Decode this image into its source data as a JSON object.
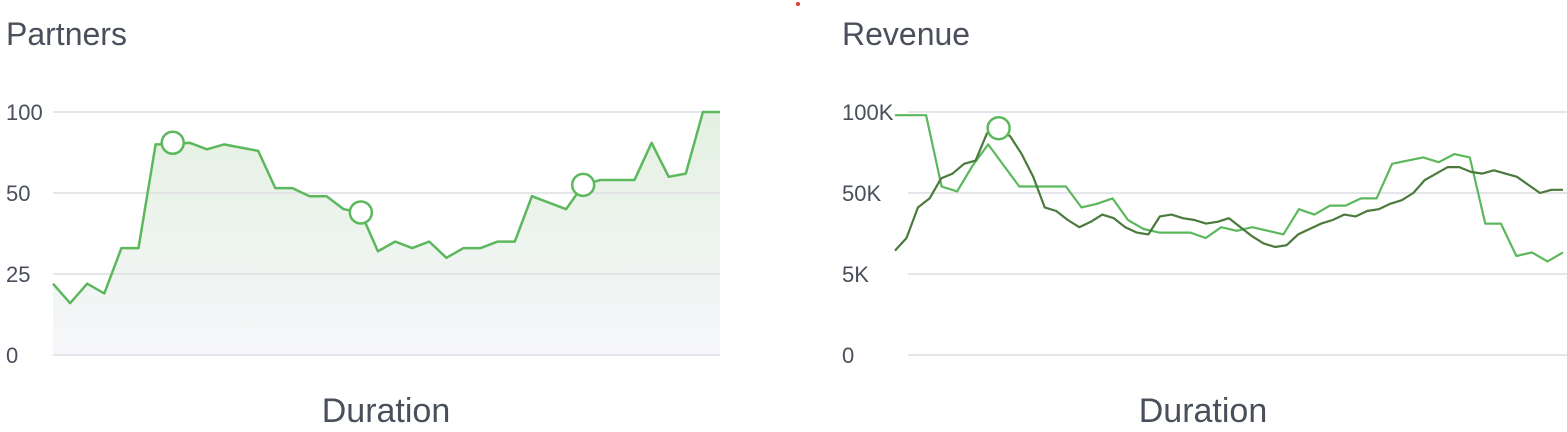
{
  "chart_data": [
    {
      "type": "area",
      "title": "Partners",
      "xlabel": "Duration",
      "ylabel": "",
      "y_ticks": [
        "0",
        "25",
        "50",
        "100"
      ],
      "ylim": [
        0,
        100
      ],
      "grid": true,
      "colors": {
        "line": "#5cb85c",
        "fill_top": "#e4f1e1",
        "fill_bottom": "#f6f6fa",
        "grid": "#dcdde3"
      },
      "series": [
        {
          "values": [
            22,
            16,
            22,
            19,
            33,
            33,
            80,
            80,
            81,
            77,
            80,
            78,
            76,
            53,
            53,
            49,
            49,
            45,
            44,
            32,
            35,
            33,
            35,
            30,
            33,
            33,
            35,
            35,
            49,
            47,
            45,
            55,
            58,
            58,
            58,
            81,
            60,
            62,
            100,
            100
          ]
        }
      ],
      "markers": [
        {
          "index": 7,
          "value": 81
        },
        {
          "index": 18,
          "value": 44
        },
        {
          "index": 31,
          "value": 55
        }
      ]
    },
    {
      "type": "line",
      "title": "Revenue",
      "xlabel": "Duration",
      "ylabel": "",
      "y_ticks": [
        "0",
        "5K",
        "50K",
        "100K"
      ],
      "ylim": [
        0,
        100000
      ],
      "grid": true,
      "colors": {
        "light": "#5cb85c",
        "dark": "#4a7a3c",
        "grid": "#dcdde3"
      },
      "series": [
        {
          "values": [
            98000,
            98000,
            98000,
            54000,
            51000,
            67000,
            80000,
            67000,
            54000,
            54000,
            54000,
            54000,
            42000,
            44000,
            47000,
            35000,
            30000,
            28000,
            28000,
            28000,
            25000,
            31000,
            29000,
            31000,
            29000,
            27000,
            41000,
            38000,
            43000,
            43000,
            47000,
            47000,
            68000,
            70000,
            72000,
            69000,
            74000,
            72000,
            33000,
            33000,
            15000,
            17000,
            12000,
            17000
          ]
        },
        {
          "values": [
            18000,
            25000,
            42000,
            47000,
            59000,
            62000,
            68000,
            70000,
            87000,
            90000,
            85000,
            74000,
            60000,
            42000,
            40000,
            35000,
            31000,
            34000,
            38000,
            36000,
            31000,
            28000,
            27000,
            37000,
            38000,
            36000,
            35000,
            33000,
            34000,
            36000,
            31000,
            26000,
            22000,
            20000,
            21000,
            27000,
            30000,
            33000,
            35000,
            38000,
            37000,
            40000,
            41000,
            44000,
            46000,
            50000,
            58000,
            62000,
            66000,
            66000,
            63000,
            62000,
            64000,
            62000,
            60000,
            55000,
            50000,
            52000,
            52000
          ]
        }
      ],
      "markers": [
        {
          "series": 1,
          "index": 9,
          "value": 90000
        }
      ]
    }
  ]
}
